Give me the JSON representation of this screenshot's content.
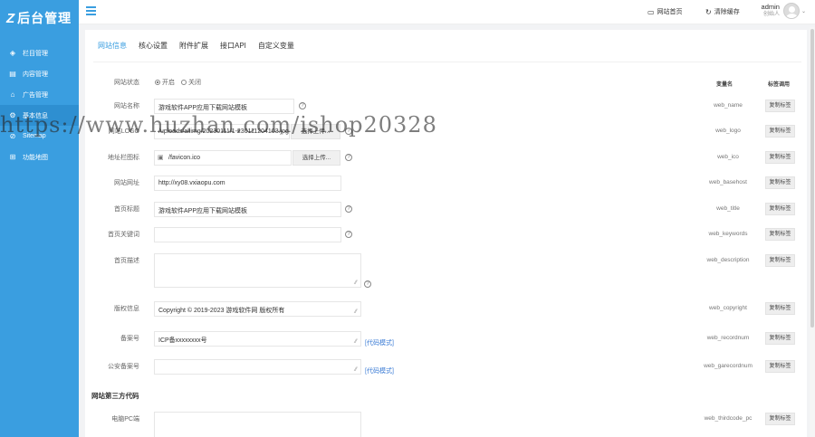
{
  "app": {
    "logo_mark": "Z",
    "title": "后台管理"
  },
  "sidebar": {
    "items": [
      {
        "icon": "layers-icon",
        "glyph": "◈",
        "label": "栏目管理"
      },
      {
        "icon": "document-icon",
        "glyph": "▤",
        "label": "内容管理"
      },
      {
        "icon": "ad-icon",
        "glyph": "⌂",
        "label": "广告管理"
      },
      {
        "icon": "gear-icon",
        "glyph": "⚙",
        "label": "基本信息"
      },
      {
        "icon": "circle-icon",
        "glyph": "⊘",
        "label": "Sitemap"
      },
      {
        "icon": "grid-icon",
        "glyph": "⊞",
        "label": "功能地图"
      }
    ]
  },
  "topbar": {
    "home_icon": "▭",
    "home_label": "网站首页",
    "cache_icon": "↻",
    "cache_label": "清除缓存",
    "username": "admin",
    "role": "创始人",
    "caret": "⌄"
  },
  "tabs": [
    "网站信息",
    "核心设置",
    "附件扩展",
    "接口API",
    "自定义变量"
  ],
  "columns": {
    "varname": "变量名",
    "tag": "标签调用"
  },
  "copy_label": "复制标签",
  "help_glyph": "?",
  "resize_glyph": "⁄⁄",
  "code_mode": "[代码模式]",
  "status": {
    "label": "网站状态",
    "on": "开启",
    "off": "关闭"
  },
  "fields": {
    "name": {
      "label": "网站名称",
      "value": "游戏软件APP应用下载网站模板",
      "var": "web_name"
    },
    "logo": {
      "label": "网站LOGO",
      "value": "/uploads/allimg/20230111/1-230111204103.jpg",
      "button": "选择上传...",
      "var": "web_logo"
    },
    "ico": {
      "label": "地址栏图标",
      "value": "/favicon.ico",
      "button": "选择上传...",
      "var": "web_ico"
    },
    "url": {
      "label": "网站网址",
      "value": "http://xy08.vxiaopu.com",
      "var": "web_basehost"
    },
    "title": {
      "label": "首页标题",
      "value": "游戏软件APP应用下载网站模板",
      "var": "web_title"
    },
    "keywords": {
      "label": "首页关键词",
      "value": "",
      "var": "web_keywords"
    },
    "description": {
      "label": "首页描述",
      "value": "",
      "var": "web_description"
    },
    "copyright": {
      "label": "版权信息",
      "value": "Copyright © 2019-2023 游戏软件网 版权所有",
      "var": "web_copyright"
    },
    "record": {
      "label": "备案号",
      "value": "ICP备xxxxxxxx号",
      "var": "web_recordnum"
    },
    "garecord": {
      "label": "公安备案号",
      "value": "",
      "var": "web_garecordnum"
    },
    "pc": {
      "label": "电脑PC端",
      "value": "",
      "var": "web_thirdcode_pc"
    }
  },
  "section_thirdparty": "网站第三方代码",
  "watermark": "https://www.huzhan.com/ishop20328"
}
